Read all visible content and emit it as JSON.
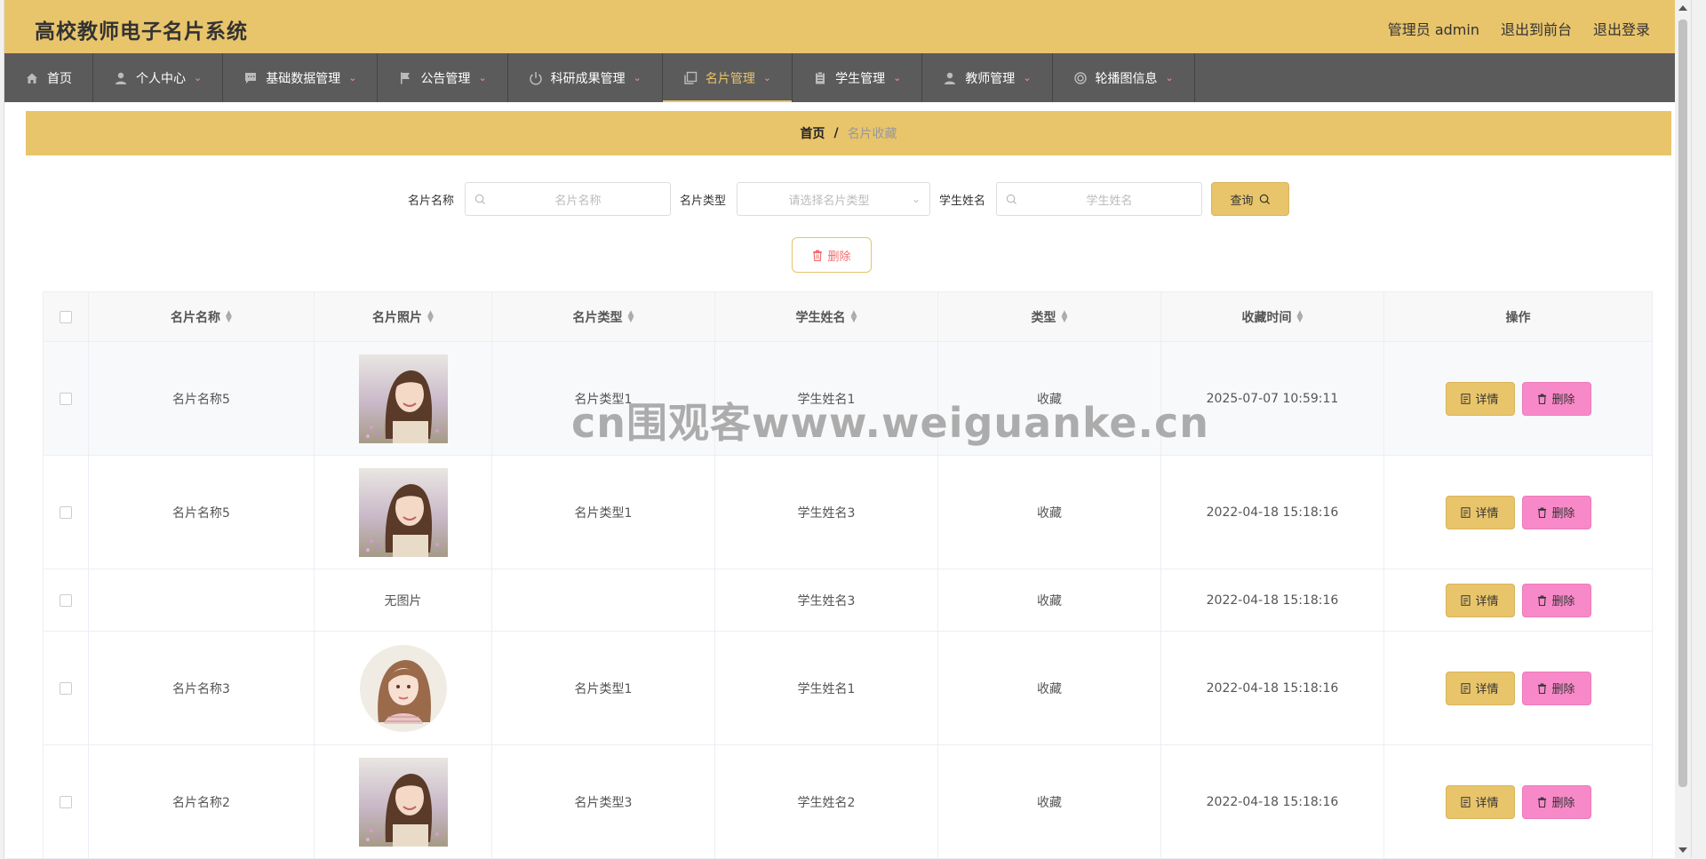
{
  "app": {
    "title": "高校教师电子名片系统"
  },
  "top_right": {
    "admin": "管理员 admin",
    "to_front": "退出到前台",
    "logout": "退出登录"
  },
  "nav": [
    {
      "label": "首页",
      "icon": "home-icon"
    },
    {
      "label": "个人中心",
      "icon": "user-icon"
    },
    {
      "label": "基础数据管理",
      "icon": "chat-icon"
    },
    {
      "label": "公告管理",
      "icon": "flag-icon"
    },
    {
      "label": "科研成果管理",
      "icon": "power-icon"
    },
    {
      "label": "名片管理",
      "icon": "copy-icon"
    },
    {
      "label": "学生管理",
      "icon": "clipboard-icon"
    },
    {
      "label": "教师管理",
      "icon": "person-icon"
    },
    {
      "label": "轮播图信息",
      "icon": "ring-icon"
    }
  ],
  "breadcrumb": {
    "home": "首页",
    "sep": "/",
    "current": "名片收藏"
  },
  "search": {
    "name_label": "名片名称",
    "name_placeholder": "名片名称",
    "type_label": "名片类型",
    "type_placeholder": "请选择名片类型",
    "student_label": "学生姓名",
    "student_placeholder": "学生姓名",
    "query_label": "查询"
  },
  "batch_delete_label": "删除",
  "table": {
    "headers": [
      "名片名称",
      "名片照片",
      "名片类型",
      "学生姓名",
      "类型",
      "收藏时间",
      "操作"
    ],
    "rows": [
      {
        "name": "名片名称5",
        "photo": "portrait-photo",
        "photo_text": "",
        "type": "名片类型1",
        "student": "学生姓名1",
        "kind": "收藏",
        "time": "2025-07-07 10:59:11"
      },
      {
        "name": "名片名称5",
        "photo": "portrait-photo",
        "photo_text": "",
        "type": "名片类型1",
        "student": "学生姓名3",
        "kind": "收藏",
        "time": "2022-04-18 15:18:16"
      },
      {
        "name": "",
        "photo": "",
        "photo_text": "无图片",
        "type": "",
        "student": "学生姓名3",
        "kind": "收藏",
        "time": "2022-04-18 15:18:16"
      },
      {
        "name": "名片名称3",
        "photo": "drawing-photo",
        "photo_text": "",
        "type": "名片类型1",
        "student": "学生姓名1",
        "kind": "收藏",
        "time": "2022-04-18 15:18:16"
      },
      {
        "name": "名片名称2",
        "photo": "portrait-photo",
        "photo_text": "",
        "type": "名片类型3",
        "student": "学生姓名2",
        "kind": "收藏",
        "time": "2022-04-18 15:18:16"
      }
    ],
    "detail_label": "详情",
    "delete_label": "删除"
  },
  "watermark": "cn围观客www.weiguanke.cn",
  "colors": {
    "primary": "#e8c46b",
    "nav": "#5b5b5b",
    "delete": "#f889c9",
    "danger_text": "#f56c6c"
  }
}
